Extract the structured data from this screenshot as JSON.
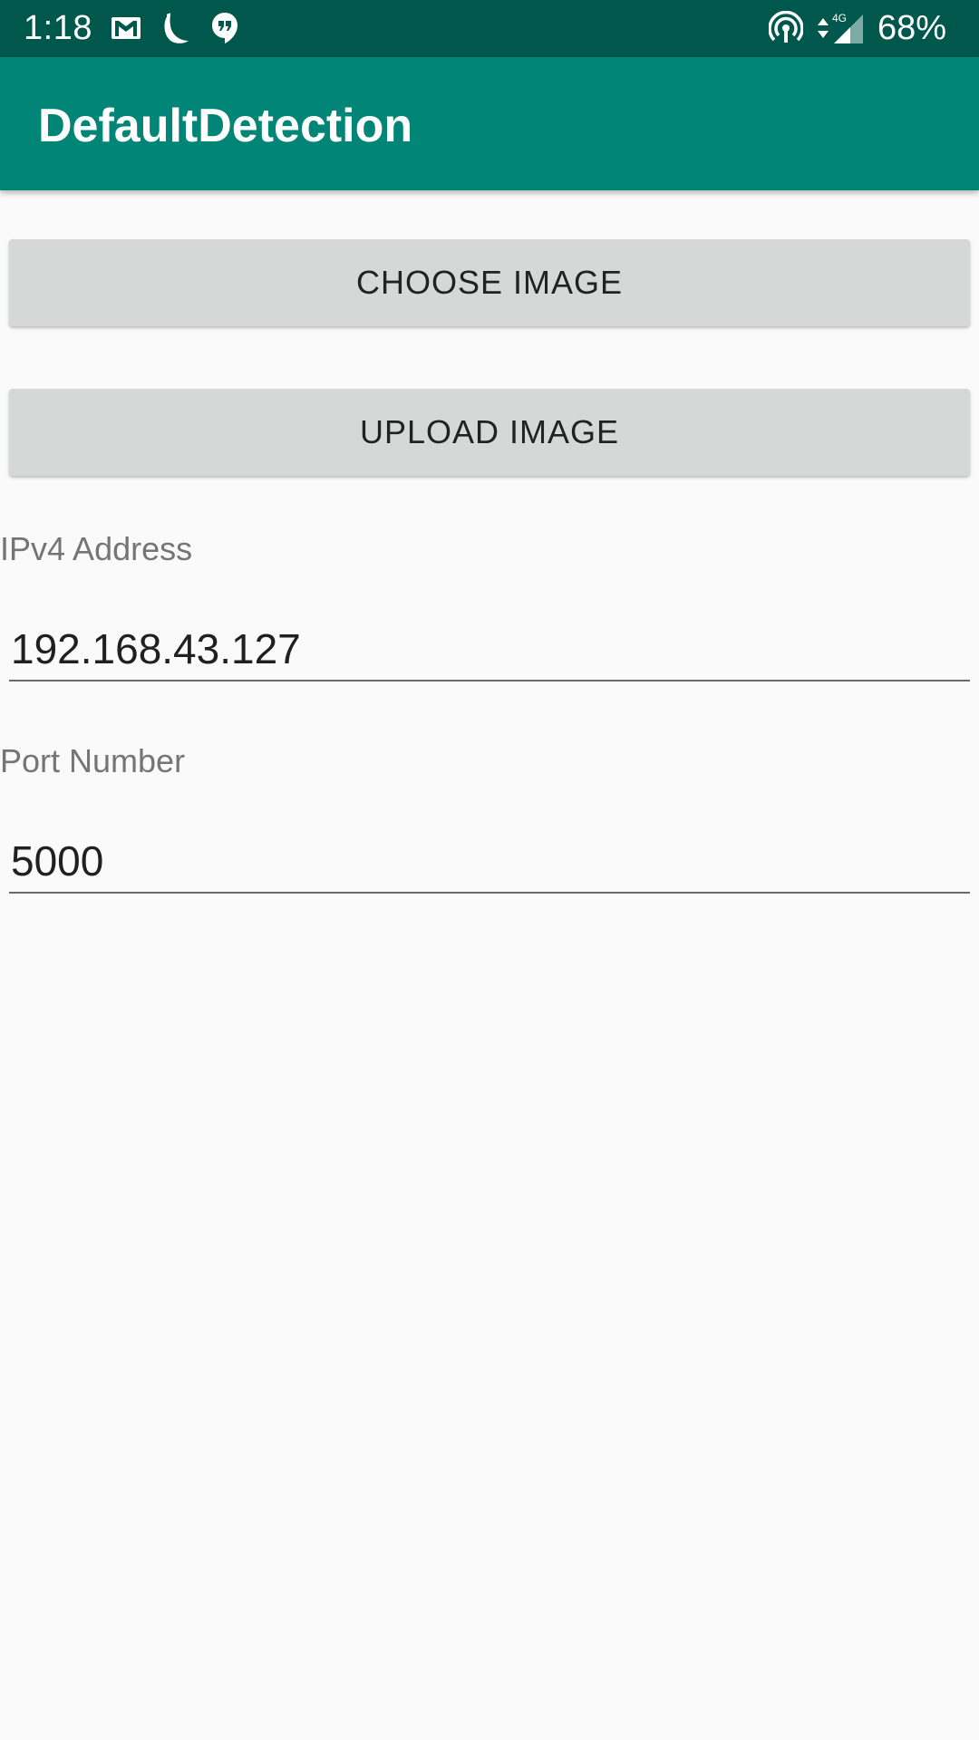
{
  "status_bar": {
    "time": "1:18",
    "battery": "68%",
    "network_type": "4G",
    "background_color": "#00574b",
    "left_icons": [
      "gmail-icon",
      "moon-crescent-icon",
      "hangouts-icon"
    ],
    "right_icons": [
      "hotspot-icon",
      "data-arrows-icon",
      "signal-icon"
    ]
  },
  "app_bar": {
    "title": "DefaultDetection",
    "background_color": "#008577"
  },
  "buttons": {
    "choose_image": "CHOOSE IMAGE",
    "upload_image": "UPLOAD IMAGE"
  },
  "fields": {
    "ip": {
      "label": "IPv4 Address",
      "value": "192.168.43.127"
    },
    "port": {
      "label": "Port Number",
      "value": "5000"
    }
  }
}
